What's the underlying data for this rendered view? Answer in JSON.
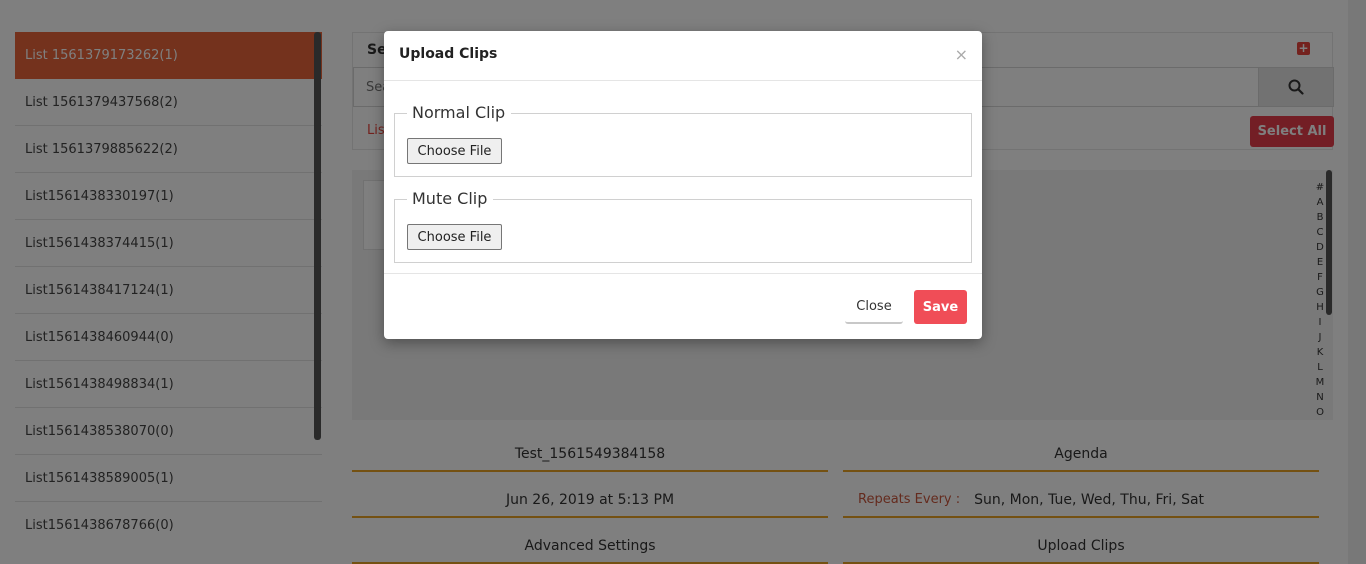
{
  "sidebar": {
    "items": [
      {
        "label": "List 1561379173262(1)"
      },
      {
        "label": "List 1561379437568(2)"
      },
      {
        "label": "List 1561379885622(2)"
      },
      {
        "label": "List1561438330197(1)"
      },
      {
        "label": "List1561438374415(1)"
      },
      {
        "label": "List1561438417124(1)"
      },
      {
        "label": "List1561438460944(0)"
      },
      {
        "label": "List1561438498834(1)"
      },
      {
        "label": "List1561438538070(0)"
      },
      {
        "label": "List1561438589005(1)"
      },
      {
        "label": "List1561438678766(0)"
      }
    ]
  },
  "search": {
    "title": "Se",
    "placeholder": "Sea",
    "list_label": "Lis",
    "select_all": "Select All",
    "add_icon": "+"
  },
  "alpha_index": [
    "#",
    "A",
    "B",
    "C",
    "D",
    "E",
    "F",
    "G",
    "H",
    "I",
    "J",
    "K",
    "L",
    "M",
    "N",
    "O"
  ],
  "details": {
    "name": "Test_1561549384158",
    "agenda": "Agenda",
    "datetime": "Jun 26, 2019 at 5:13 PM",
    "repeats_label": "Repeats Every :",
    "repeats_value": "Sun, Mon, Tue, Wed, Thu, Fri, Sat",
    "advanced": "Advanced Settings",
    "upload": "Upload Clips"
  },
  "modal": {
    "title": "Upload Clips",
    "close_x": "×",
    "normal_legend": "Normal Clip",
    "mute_legend": "Mute Clip",
    "choose_file": "Choose File",
    "close_label": "Close",
    "save_label": "Save"
  },
  "colors": {
    "active_item": "#e8643a",
    "accent_red": "#e63c4a",
    "save_red": "#f04d57",
    "underline_orange": "#e8a325"
  }
}
